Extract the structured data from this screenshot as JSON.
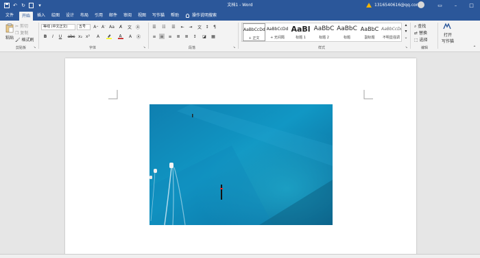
{
  "window": {
    "doc_title": "文档1 - Word",
    "account_email": "1316540616@qq.com"
  },
  "tabs": [
    "文件",
    "开始",
    "插入",
    "绘图",
    "设计",
    "布局",
    "引用",
    "邮件",
    "审阅",
    "视图",
    "写作猫",
    "帮助"
  ],
  "tell_me": "操作说明搜索",
  "clipboard": {
    "paste": "粘贴",
    "cut": "剪切",
    "copy": "复制",
    "format_painter": "格式刷",
    "group": "剪贴板"
  },
  "font": {
    "name": "等线 (中文正文)",
    "size": "五号",
    "group": "字体"
  },
  "paragraph": {
    "group": "段落"
  },
  "styles": {
    "group": "样式",
    "items": [
      {
        "sample": "AaBbCcDd",
        "name": "+ 正文"
      },
      {
        "sample": "AaBbCcDd",
        "name": "+ 无间隔"
      },
      {
        "sample": "AaBl",
        "name": "标题 1"
      },
      {
        "sample": "AaBbC",
        "name": "标题 2"
      },
      {
        "sample": "AaBbC",
        "name": "标题"
      },
      {
        "sample": "AaBbC",
        "name": "副标题"
      },
      {
        "sample": "AaBbCcDd",
        "name": "不明显强调"
      }
    ]
  },
  "editing": {
    "find": "查找",
    "replace": "替换",
    "select": "选择",
    "group": "编辑"
  },
  "write_cat": {
    "line1": "打开",
    "line2": "写作猫"
  },
  "colors": {
    "ribbon_blue": "#2b579a",
    "font_color": "#c00000",
    "highlight": "#ffff00"
  }
}
